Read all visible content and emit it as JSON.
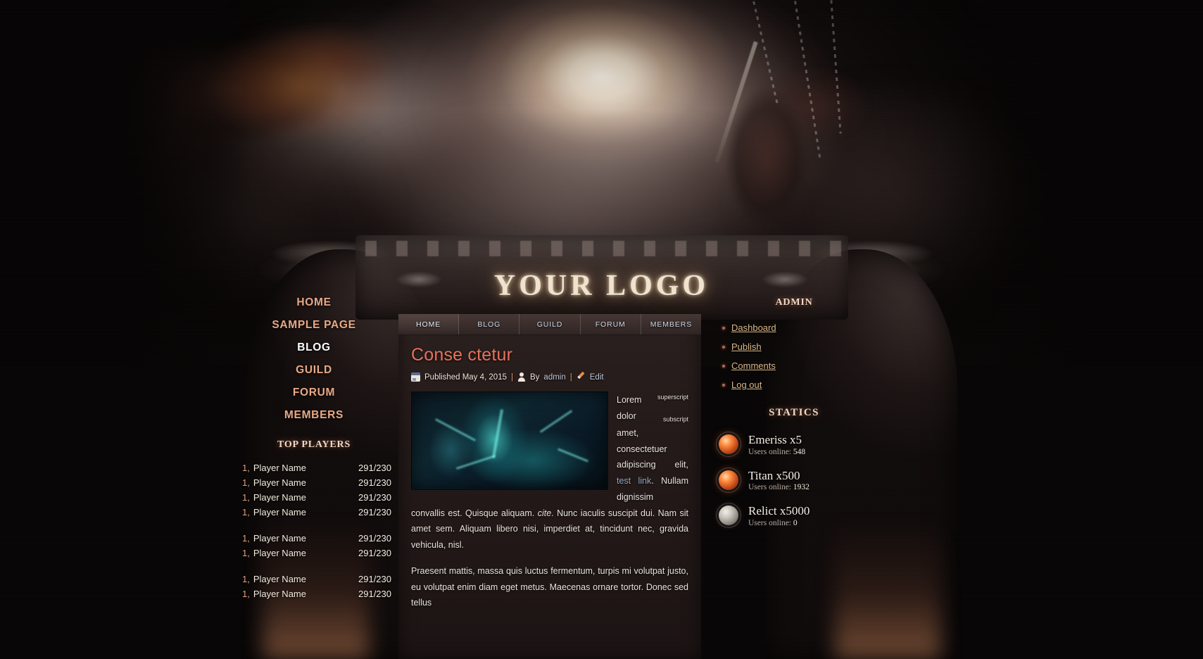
{
  "site": {
    "logo_text": "YOUR LOGO"
  },
  "sidebar_left": {
    "nav": [
      {
        "label": "HOME",
        "active": false
      },
      {
        "label": "SAMPLE PAGE",
        "active": false
      },
      {
        "label": "BLOG",
        "active": true
      },
      {
        "label": "GUILD",
        "active": false
      },
      {
        "label": "FORUM",
        "active": false
      },
      {
        "label": "MEMBERS",
        "active": false
      }
    ],
    "top_players_title": "TOP PLAYERS",
    "players": [
      {
        "rank": "1,",
        "name": "Player Name",
        "score": "291/230"
      },
      {
        "rank": "1,",
        "name": "Player Name",
        "score": "291/230"
      },
      {
        "rank": "1,",
        "name": "Player Name",
        "score": "291/230"
      },
      {
        "rank": "1,",
        "name": "Player Name",
        "score": "291/230"
      },
      {
        "rank": "1,",
        "name": "Player Name",
        "score": "291/230"
      },
      {
        "rank": "1,",
        "name": "Player Name",
        "score": "291/230"
      },
      {
        "rank": "1,",
        "name": "Player Name",
        "score": "291/230"
      },
      {
        "rank": "1,",
        "name": "Player Name",
        "score": "291/230"
      }
    ]
  },
  "main": {
    "tabs": [
      {
        "label": "HOME",
        "active": true
      },
      {
        "label": "BLOG",
        "active": false
      },
      {
        "label": "GUILD",
        "active": false
      },
      {
        "label": "FORUM",
        "active": false
      },
      {
        "label": "MEMBERS",
        "active": false
      }
    ],
    "post": {
      "title": "Conse ctetur",
      "published_label": "Published May 4, 2015",
      "separator": "|",
      "by_label": "By",
      "author": "admin",
      "edit_label": "Edit",
      "para1_lead": "Lorem",
      "para1_sup": "superscript",
      "para1_mid": "dolor",
      "para1_sub": "subscript",
      "para1_a": "amet, consectetuer adipiscing elit,",
      "para1_link": "test link",
      "para1_b": ". Nullam dignissim convallis est. Quisque aliquam.",
      "para1_cite": "cite",
      "para1_c": ". Nunc iaculis suscipit dui. Nam sit amet sem. Aliquam libero nisi, imperdiet at, tincidunt nec, gravida vehicula, nisl.",
      "para2": "Praesent mattis, massa quis luctus fermentum, turpis mi volutpat justo, eu volutpat enim diam eget metus. Maecenas ornare tortor. Donec sed tellus"
    }
  },
  "sidebar_right": {
    "admin_title": "ADMIN",
    "admin_links": [
      {
        "label": "Dashboard"
      },
      {
        "label": "Publish"
      },
      {
        "label": "Comments"
      },
      {
        "label": "Log out"
      }
    ],
    "statics_title": "STATICS",
    "servers": [
      {
        "name": "Emeriss x5",
        "users_label": "Users online:",
        "users_count": "548",
        "status": "online"
      },
      {
        "name": "Titan x500",
        "users_label": "Users online:",
        "users_count": "1932",
        "status": "online"
      },
      {
        "name": "Relict x5000",
        "users_label": "Users online:",
        "users_count": "0",
        "status": "offline"
      }
    ]
  },
  "colors": {
    "accent_salmon": "#e8a886",
    "title_coral": "#e8715a",
    "admin_link": "#d8b887",
    "orb_online": "#ff8a3c",
    "orb_offline": "#c9c4bc"
  }
}
